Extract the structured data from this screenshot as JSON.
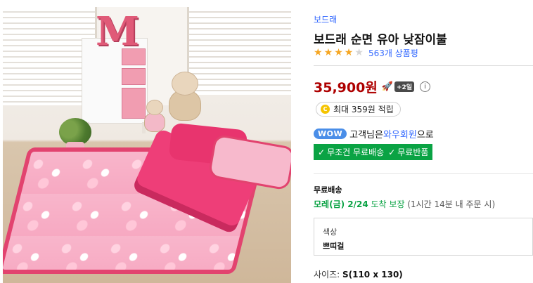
{
  "product": {
    "brand": "보드래",
    "title": "보드래 순면 유아 낮잠이불",
    "rating": {
      "stars": 4,
      "max": 5
    },
    "review_link": "563개 상품평",
    "price": "35,900원",
    "rocket_badge": "+2일",
    "cash_reward": "최대 359원 적립",
    "coin_symbol": "C",
    "wow": {
      "badge": "WOW",
      "text_prefix": "고객님은 ",
      "member_link": "와우회원",
      "text_suffix": "으로"
    },
    "benefit": {
      "free_shipping": "무조건 무료배송",
      "free_return": "무료반품"
    },
    "shipping": {
      "label": "무료배송",
      "date": "모레(금) 2/24",
      "arrive": " 도착 보장",
      "note": " (1시간 14분 내 주문 시)"
    },
    "option": {
      "label": "색상",
      "value": "쁘띠걸"
    },
    "size": {
      "label": "사이즈: ",
      "value": "S(110 x 130)"
    }
  },
  "image": {
    "alt": "핑크 유아 낮잠이불 상품 이미지",
    "letter": "M"
  },
  "colors": {
    "brand_link": "#346aff",
    "price": "#ae0000",
    "benefit_green": "#0aa344",
    "star": "#f5a623",
    "wow_blue": "#4a8ee8"
  },
  "icons": [
    "rocket-icon",
    "info-icon",
    "coin-icon",
    "check-icon",
    "star-icon"
  ]
}
